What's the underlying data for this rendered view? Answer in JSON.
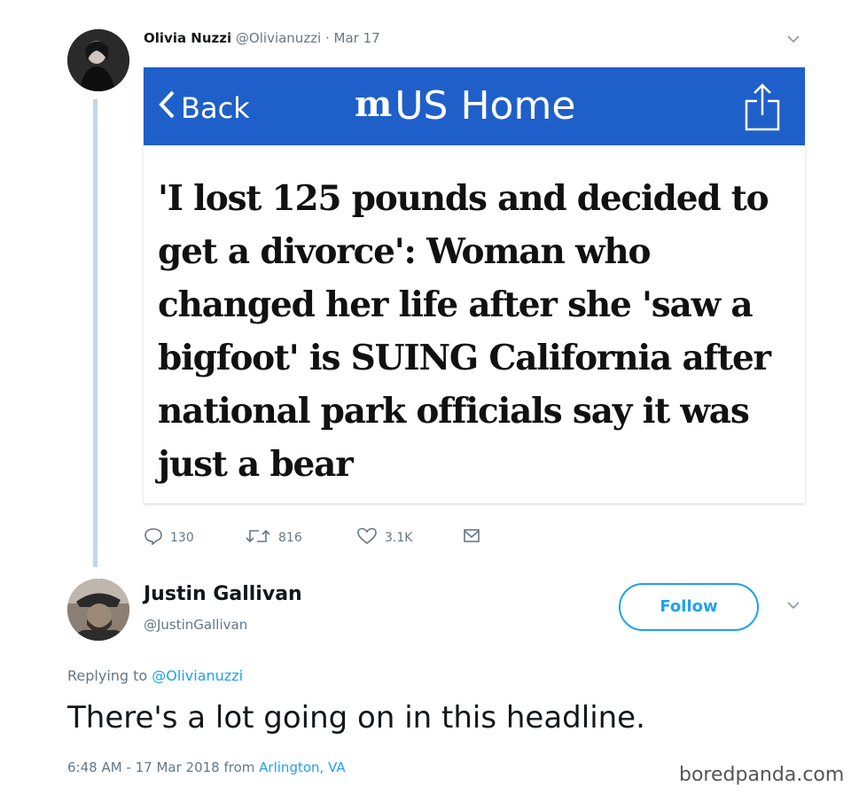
{
  "tweet": {
    "author_name": "Olivia Nuzzi",
    "author_handle": "@Olivianuzzi",
    "date": "· Mar 17",
    "card": {
      "back_label": "Back",
      "brand_title": "US Home",
      "headline": "'I lost 125 pounds and decided to get a divorce': Woman who changed her life after she 'saw a bigfoot' is SUING California after national park officials say it was just a bear"
    },
    "actions": {
      "replies": "130",
      "retweets": "816",
      "likes": "3.1K"
    }
  },
  "reply": {
    "author_name": "Justin Gallivan",
    "author_handle": "@JustinGallivan",
    "follow_label": "Follow",
    "replying_prefix": "Replying to",
    "replying_handle": "@Olivianuzzi",
    "text": "There's a lot going on in this headline.",
    "timestamp": "6:48 AM - 17 Mar 2018 from",
    "location": "Arlington, VA"
  },
  "watermark": "boredpanda.com",
  "colors": {
    "appbar": "#1f5fc9",
    "link": "#1da1f2",
    "muted": "#657786",
    "thread_line": "#c4d5ea"
  },
  "icons": [
    "chevron-down-icon",
    "back-chevron-icon",
    "share-icon",
    "reply-icon",
    "retweet-icon",
    "like-icon",
    "dm-icon"
  ]
}
